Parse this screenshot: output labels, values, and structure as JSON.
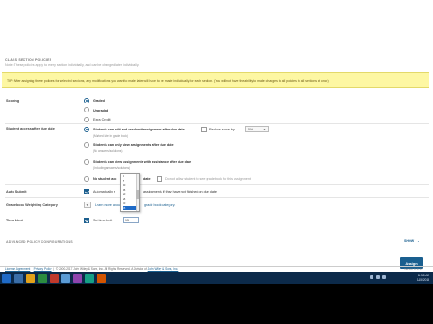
{
  "section": {
    "title": "CLASS SECTION POLICIES",
    "note": "Note: These policies apply to every section individually, and can be changed later individually."
  },
  "tip": "TIP: After assigning these policies for selected sections, any modifications you want to make later will have to be made individually for each section. (You will not have the ability to make changes to all policies to all sections at once)",
  "scoring": {
    "label": "Scoring",
    "options": [
      "Graded",
      "Ungraded",
      "Extra Credit"
    ]
  },
  "after_due": {
    "label": "Student access after due date",
    "opt1": "Students can edit and resubmit assignment after due date",
    "opt1_note": "(Marked late in grade book)",
    "reduce_label": "Reduce score by",
    "reduce_value": "5%",
    "opt2": "Students can only view assignments after due date",
    "opt2_note": "(No answers/solutions)",
    "opt3": "Students can view assignments with assistance after due date",
    "opt3_note": "(Including answers/solutions)",
    "opt4": "No student access after due date",
    "opt4_partial_a": "No student acc",
    "opt4_partial_b": "date",
    "do_not_allow": "Do not allow student to see gradebook for this assignment"
  },
  "dropdown": {
    "items": [
      "0",
      "5",
      "10",
      "15",
      "20",
      "25",
      "30",
      "35",
      "40"
    ]
  },
  "auto_submit": {
    "label": "Auto Submit",
    "text_a": "Automatically s",
    "text_b": "assignments if they have not finished on due date"
  },
  "gradebook": {
    "label": "Gradebook Weighting Category",
    "select_value": "",
    "text_a": "Learn more about how",
    "text_b": "grade book category."
  },
  "time_limit": {
    "label": "Time Limit",
    "text": "Set time limit",
    "input_value": "15"
  },
  "advanced": {
    "label": "ADVANCED POLICY CONFIGURATIONS",
    "show": "SHOW"
  },
  "assign_button": "Assign",
  "footer": {
    "license": "License Agreement",
    "privacy": "Privacy Policy",
    "copyright": "© 2000-2017 John Wiley & Sons, Inc. All Rights Reserved. A Division of",
    "company": "John Wiley & Sons, Inc.",
    "version": "Version 4.14.17"
  },
  "taskbar": {
    "time": "11:58 AM",
    "date": "1/15/2018"
  },
  "colors": {
    "accent": "#1a5f8f",
    "tip_bg": "#fdf7a3",
    "taskbar": "#0c2a4a"
  }
}
